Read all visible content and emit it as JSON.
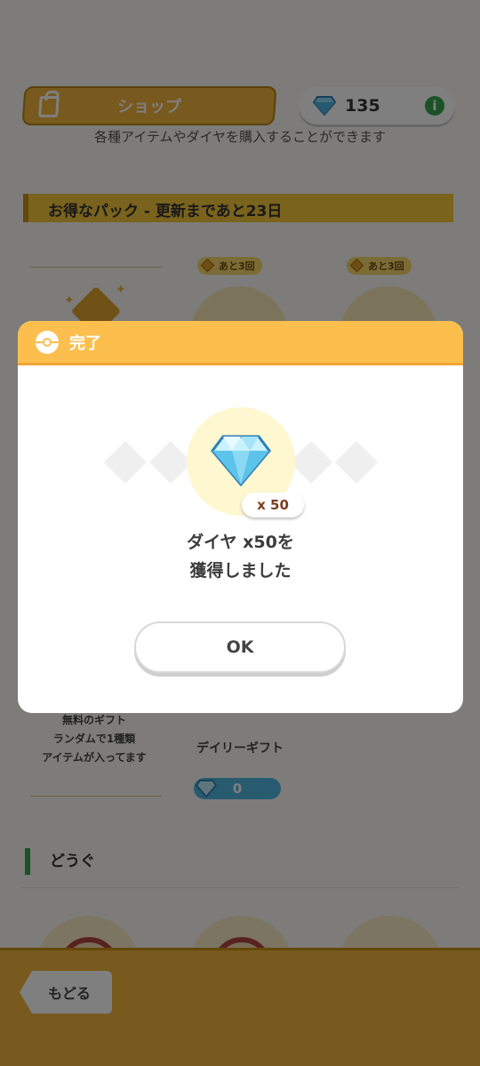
{
  "shop": {
    "title": "ショップ",
    "diamond_count": "135",
    "info_icon": "i",
    "subtitle": "各種アイテムやダイヤを購入することができます"
  },
  "deals": {
    "heading": "お得なパック - 更新まであと23日",
    "badges": [
      "あと3回",
      "あと3回"
    ],
    "free_gift_lines": [
      "無料のギフト",
      "ランダムで1種類",
      "アイテムが入ってます"
    ],
    "daily_gift_label": "デイリーギフト",
    "daily_gift_price": "0"
  },
  "tools": {
    "heading": "どうぐ"
  },
  "nav": {
    "back_label": "もどる"
  },
  "dialog": {
    "title": "完了",
    "quantity": "x 50",
    "message_line1": "ダイヤ x50を",
    "message_line2": "獲得しました",
    "ok_label": "OK"
  },
  "icons": {
    "header": "shopping-bag-icon",
    "currency": "diamond-icon",
    "info": "info-icon",
    "dialog_header": "poke-ball-icon",
    "reward": "diamond-icon"
  },
  "colors": {
    "accent_orange": "#fcbf4e",
    "shop_gold": "#f0b33c",
    "info_green": "#35a54a",
    "diamond_blue": "#51b6df"
  }
}
